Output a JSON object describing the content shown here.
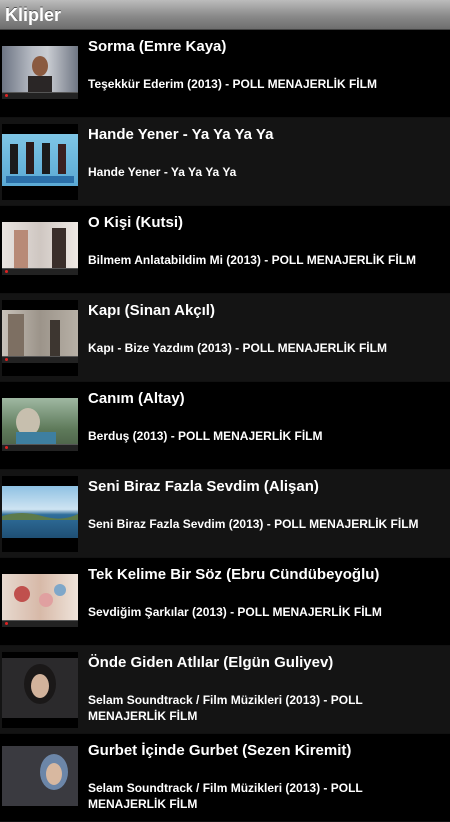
{
  "header": {
    "title": "Klipler"
  },
  "items": [
    {
      "title": "Sorma (Emre Kaya)",
      "subtitle": "Teşekkür Ederim (2013) - POLL MENAJERLİK FİLM",
      "thumb": "man-portrait-thumbnail"
    },
    {
      "title": "Hande Yener - Ya Ya Ya Ya",
      "subtitle": "Hande Yener - Ya Ya Ya Ya",
      "thumb": "dancers-thumbnail"
    },
    {
      "title": "O Kişi (Kutsi)",
      "subtitle": "Bilmem Anlatabildim Mi (2013) - POLL MENAJERLİK FİLM",
      "thumb": "women-thumbnail"
    },
    {
      "title": "Kapı (Sinan Akçıl)",
      "subtitle": "Kapı - Bize Yazdım (2013) - POLL MENAJERLİK FİLM",
      "thumb": "street-thumbnail"
    },
    {
      "title": "Canım (Altay)",
      "subtitle": "Berduş (2013) - POLL MENAJERLİK FİLM",
      "thumb": "outdoor-thumbnail"
    },
    {
      "title": "Seni Biraz Fazla Sevdim (Alişan)",
      "subtitle": "Seni Biraz Fazla Sevdim (2013) - POLL MENAJERLİK FİLM",
      "thumb": "sea-landscape-thumbnail"
    },
    {
      "title": "Tek Kelime Bir Söz (Ebru Cündübeyoğlu)",
      "subtitle": "Sevdiğim Şarkılar (2013) - POLL MENAJERLİK FİLM",
      "thumb": "flowers-thumbnail"
    },
    {
      "title": "Önde Giden Atlılar (Elgün Guliyev)",
      "subtitle": "Selam Soundtrack / Film Müzikleri (2013) - POLL MENAJERLİK FİLM",
      "thumb": "woman-headscarf-thumbnail"
    },
    {
      "title": "Gurbet İçinde Gurbet (Sezen Kiremit)",
      "subtitle": "Selam Soundtrack / Film Müzikleri (2013) - POLL MENAJERLİK FİLM",
      "thumb": "woman-headscarf-thumbnail"
    }
  ]
}
